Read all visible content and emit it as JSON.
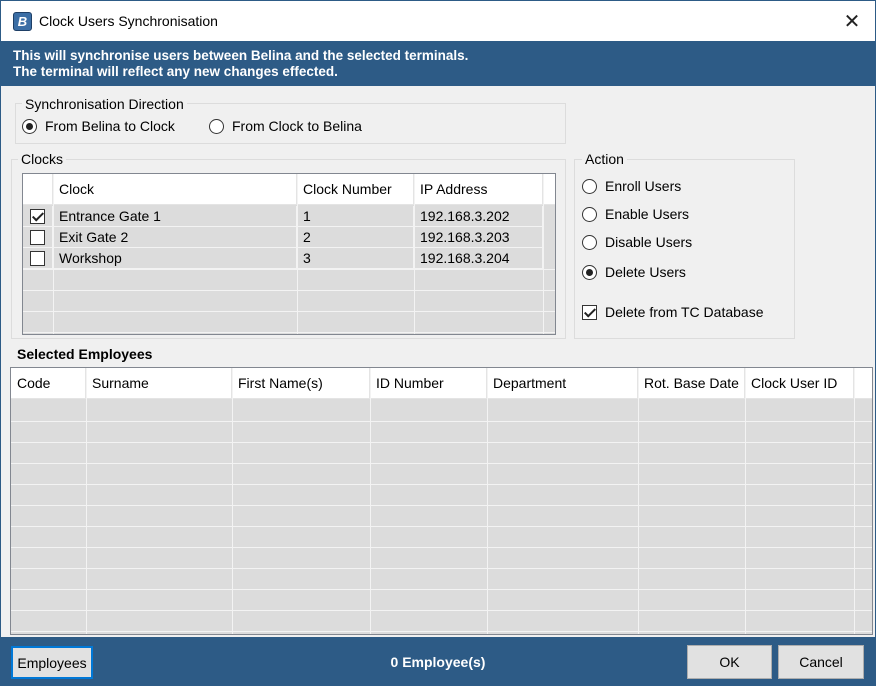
{
  "window": {
    "title": "Clock Users Synchronisation",
    "icon": "belina-app-icon",
    "close_glyph": "✕"
  },
  "banner": {
    "line1": "This will synchronise users between Belina and the selected terminals.",
    "line2": "The terminal will reflect any new changes effected."
  },
  "sync_direction": {
    "label": "Synchronisation Direction",
    "options": [
      {
        "label": "From Belina to Clock",
        "selected": true
      },
      {
        "label": "From Clock to Belina",
        "selected": false
      }
    ]
  },
  "clocks": {
    "label": "Clocks",
    "columns": [
      "",
      "Clock",
      "Clock Number",
      "IP Address"
    ],
    "rows": [
      {
        "checked": true,
        "clock": "Entrance Gate 1",
        "number": "1",
        "ip": "192.168.3.202"
      },
      {
        "checked": false,
        "clock": "Exit Gate 2",
        "number": "2",
        "ip": "192.168.3.203"
      },
      {
        "checked": false,
        "clock": "Workshop",
        "number": "3",
        "ip": "192.168.3.204"
      }
    ]
  },
  "action": {
    "label": "Action",
    "options": [
      {
        "label": "Enroll Users",
        "selected": false
      },
      {
        "label": "Enable Users",
        "selected": false
      },
      {
        "label": "Disable Users",
        "selected": false
      },
      {
        "label": "Delete Users",
        "selected": true
      }
    ],
    "delete_from_db": {
      "label": "Delete from TC Database",
      "checked": true
    }
  },
  "employees": {
    "label": "Selected Employees",
    "columns": [
      "Code",
      "Surname",
      "First Name(s)",
      "ID Number",
      "Department",
      "Rot. Base Date",
      "Clock User ID"
    ]
  },
  "footer": {
    "employees_button": "Employees",
    "count_text": "0 Employee(s)",
    "ok_button": "OK",
    "cancel_button": "Cancel"
  },
  "colors": {
    "accent": "#2d5b86",
    "grid_fill": "#dcdcdc"
  }
}
